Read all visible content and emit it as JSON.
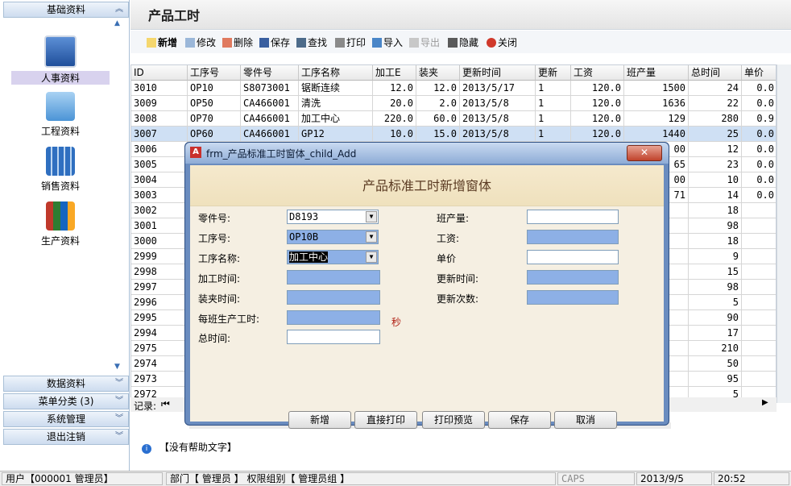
{
  "nav": {
    "top_header": "基础资料",
    "items": [
      {
        "label": "人事资料",
        "icon": "personnel-icon",
        "selected": true
      },
      {
        "label": "工程资料",
        "icon": "folder-icon",
        "selected": false
      },
      {
        "label": "销售资料",
        "icon": "calculator-icon",
        "selected": false
      },
      {
        "label": "生产资料",
        "icon": "books-icon",
        "selected": false
      }
    ],
    "bottom_headers": [
      "数据资料",
      "菜单分类 (3)",
      "系统管理",
      "退出注销"
    ]
  },
  "page_title": "产品工时",
  "toolbar": {
    "new": "新增",
    "edit": "修改",
    "delete": "删除",
    "save": "保存",
    "find": "查找",
    "print": "打印",
    "import": "导入",
    "export": "导出",
    "hide": "隐藏",
    "close": "关闭"
  },
  "grid": {
    "columns": [
      "ID",
      "工序号",
      "零件号",
      "工序名称",
      "加工E",
      "装夹",
      "更新时间",
      "更新",
      "工资",
      "班产量",
      "总时间",
      "单价"
    ],
    "rows": [
      [
        "3010",
        "OP10",
        "S8073001",
        "锯断连续",
        "12.0",
        "12.0",
        "2013/5/17",
        "1",
        "120.0",
        "1500",
        "24",
        "0.0"
      ],
      [
        "3009",
        "OP50",
        "CA466001",
        "清洗",
        "20.0",
        "2.0",
        "2013/5/8",
        "1",
        "120.0",
        "1636",
        "22",
        "0.0"
      ],
      [
        "3008",
        "OP70",
        "CA466001",
        "加工中心",
        "220.0",
        "60.0",
        "2013/5/8",
        "1",
        "120.0",
        "129",
        "280",
        "0.9"
      ],
      [
        "3007",
        "OP60",
        "CA466001",
        "GP12",
        "10.0",
        "15.0",
        "2013/5/8",
        "1",
        "120.0",
        "1440",
        "25",
        "0.0"
      ],
      [
        "3006",
        "",
        "",
        "",
        "",
        "",
        "",
        "",
        "",
        "00",
        "12",
        "0.0"
      ],
      [
        "3005",
        "",
        "",
        "",
        "",
        "",
        "",
        "",
        "",
        "65",
        "23",
        "0.0"
      ],
      [
        "3004",
        "",
        "",
        "",
        "",
        "",
        "",
        "",
        "",
        "00",
        "10",
        "0.0"
      ],
      [
        "3003",
        "",
        "",
        "",
        "",
        "",
        "",
        "",
        "",
        "71",
        "14",
        "0.0"
      ],
      [
        "3002",
        "",
        "",
        "",
        "",
        "",
        "",
        "",
        "",
        "",
        "18",
        ""
      ],
      [
        "3001",
        "",
        "",
        "",
        "",
        "",
        "",
        "",
        "",
        "",
        "98",
        ""
      ],
      [
        "3000",
        "",
        "",
        "",
        "",
        "",
        "",
        "",
        "",
        "",
        "18",
        ""
      ],
      [
        "2999",
        "",
        "",
        "",
        "",
        "",
        "",
        "",
        "",
        "",
        "9",
        ""
      ],
      [
        "2998",
        "",
        "",
        "",
        "",
        "",
        "",
        "",
        "",
        "",
        "15",
        ""
      ],
      [
        "2997",
        "",
        "",
        "",
        "",
        "",
        "",
        "",
        "",
        "",
        "98",
        ""
      ],
      [
        "2996",
        "",
        "",
        "",
        "",
        "",
        "",
        "",
        "",
        "",
        "5",
        ""
      ],
      [
        "2995",
        "",
        "",
        "",
        "",
        "",
        "",
        "",
        "",
        "",
        "90",
        ""
      ],
      [
        "2994",
        "",
        "",
        "",
        "",
        "",
        "",
        "",
        "",
        "",
        "17",
        ""
      ],
      [
        "2975",
        "",
        "",
        "",
        "",
        "",
        "",
        "",
        "",
        "",
        "210",
        ""
      ],
      [
        "2974",
        "",
        "",
        "",
        "",
        "",
        "",
        "",
        "",
        "",
        "50",
        ""
      ],
      [
        "2973",
        "",
        "",
        "",
        "",
        "",
        "",
        "",
        "",
        "",
        "95",
        ""
      ],
      [
        "2972",
        "",
        "",
        "",
        "",
        "",
        "",
        "",
        "",
        "",
        "5",
        ""
      ]
    ],
    "selected_row": 3,
    "record_label": "记录:"
  },
  "help_text": "【没有帮助文字】",
  "status": {
    "user": "用户【000001 管理员】",
    "dept": "部门【 管理员 】 权限组别【 管理员组 】",
    "caps": "CAPS",
    "date": "2013/9/5",
    "time": "20:52"
  },
  "dialog": {
    "window_title": "frm_产品标准工时窗体_child_Add",
    "header": "产品标准工时新增窗体",
    "fields_left": [
      {
        "label": "零件号:",
        "value": "D8193",
        "dropdown": true,
        "style": "white"
      },
      {
        "label": "工序号:",
        "value": "OP10B",
        "dropdown": true,
        "style": "blue"
      },
      {
        "label": "工序名称:",
        "value": "加工中心",
        "dropdown": true,
        "style": "blue"
      },
      {
        "label": "加工时间:",
        "value": "",
        "dropdown": false,
        "style": "blue"
      },
      {
        "label": "装夹时间:",
        "value": "",
        "dropdown": false,
        "style": "blue"
      },
      {
        "label": "每班生产工时:",
        "value": "",
        "dropdown": false,
        "style": "blue"
      },
      {
        "label": "总时间:",
        "value": "",
        "dropdown": false,
        "style": "white"
      }
    ],
    "unit_seconds": "秒",
    "fields_right": [
      {
        "label": "班产量:",
        "value": "",
        "style": "white"
      },
      {
        "label": "工资:",
        "value": "",
        "style": "blue"
      },
      {
        "label": "单价",
        "value": "",
        "style": "white"
      },
      {
        "label": "更新时间:",
        "value": "",
        "style": "blue"
      },
      {
        "label": "更新次数:",
        "value": "",
        "style": "blue"
      }
    ],
    "buttons": [
      "新增",
      "直接打印",
      "打印预览",
      "保存",
      "取消"
    ]
  },
  "colors": {
    "accent_blue": "#8db0e6",
    "selection": "#cfe0f4",
    "nav_selected": "#d8d2ee"
  }
}
